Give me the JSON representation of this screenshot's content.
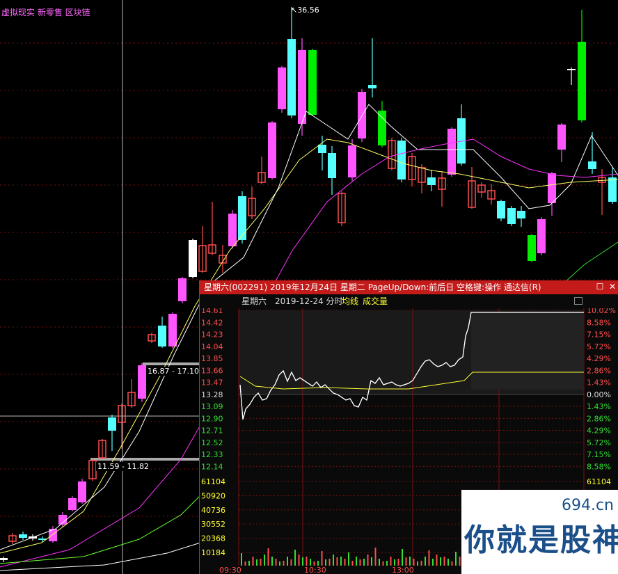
{
  "main": {
    "tags": "虚拟现实 新零售 区块链",
    "high_label": "36.56",
    "range1": "16.87 - 17.10",
    "range2": "11.59 - 11.82"
  },
  "popup": {
    "title": "星期六(002291) 2019年12月24日 星期二 PageUp/Down:前后日 空格键:操作 通达信(R)",
    "sub_name": "星期六",
    "sub_date": "2019-12-24 分时",
    "sub_avg": "均线",
    "sub_vol": "成交量",
    "price_labels": [
      "14.61",
      "14.42",
      "14.23",
      "14.04",
      "13.85",
      "13.66",
      "13.47",
      "13.28",
      "13.09",
      "12.90",
      "12.71",
      "12.52",
      "12.33",
      "12.14"
    ],
    "pct_labels": [
      "10.02%",
      "8.58%",
      "7.15%",
      "5.72%",
      "4.29%",
      "2.86%",
      "1.43%",
      "0.00%",
      "1.43%",
      "2.86%",
      "4.29%",
      "5.72%",
      "7.15%",
      "8.58%"
    ],
    "vol_labels": [
      "61104",
      "50920",
      "40736",
      "30552",
      "20368",
      "10184"
    ],
    "vol_right_top": "61104",
    "vol_right_2": "50920",
    "time_labels": [
      "09:30",
      "10:30",
      "13:00"
    ],
    "prev_close": 13.28,
    "limit_up": 14.61
  },
  "watermark": {
    "site": "694.cn",
    "text": "你就是股神"
  },
  "colors": {
    "up": "#ff4d4d",
    "pink": "#ff55ff",
    "cyan": "#55ffff",
    "green": "#00ee00",
    "grid": "#7a1010"
  }
}
